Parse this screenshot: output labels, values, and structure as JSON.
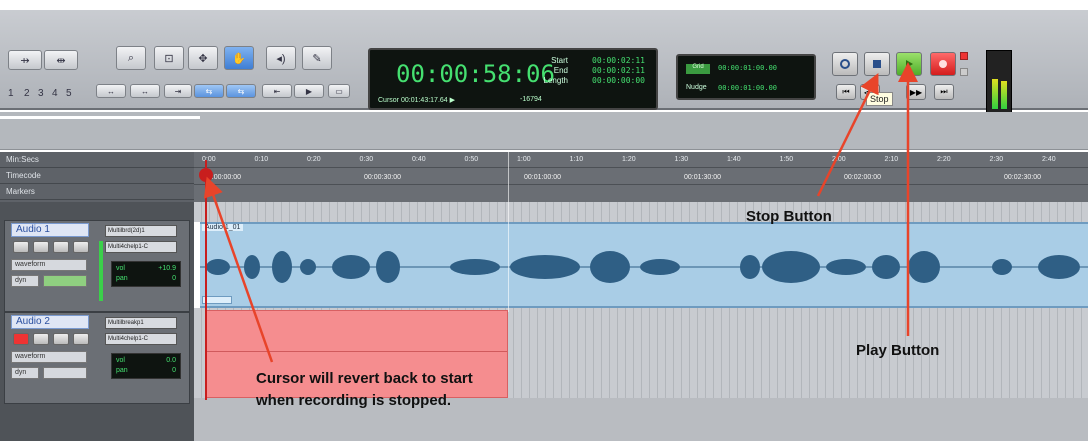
{
  "toolbar": {
    "nav_numbers": [
      "1",
      "2",
      "3",
      "4",
      "5"
    ],
    "counter": {
      "main_time": "00:00:58:06",
      "start_label": "Start",
      "end_label": "End",
      "length_label": "Length",
      "start_value": "00:00:02:11",
      "end_value": "00:00:02:11",
      "length_value": "00:00:00:00",
      "cursor_label": "Cursor",
      "cursor_value": "00:01:43:17.64",
      "bars_value": "-16794"
    },
    "nudge": {
      "grid_label": "Grid",
      "grid_value": "00:00:01:00.00",
      "nudge_label": "Nudge",
      "nudge_value": "00:00:01:00.00"
    },
    "transport": {
      "stop_tooltip": "Stop"
    }
  },
  "rulers": {
    "labels": [
      "Min:Secs",
      "Timecode",
      "Markers"
    ],
    "minsecs_ticks": [
      "0:00",
      "0:10",
      "0:20",
      "0:30",
      "0:40",
      "0:50",
      "1:00",
      "1:10",
      "1:20",
      "1:30",
      "1:40",
      "1:50",
      "2:00",
      "2:10",
      "2:20",
      "2:30",
      "2:40"
    ],
    "timecode_ticks": [
      "00:00:00:00",
      "00:00:30:00",
      "00:01:00:00",
      "00:01:30:00",
      "00:02:00:00",
      "00:02:30:00"
    ]
  },
  "tracks": [
    {
      "name": "Audio 1",
      "input": "Multilbrd(2d)1",
      "output": "Multi4chelp1-C",
      "view": "waveform",
      "dyn": "dyn",
      "vol_label": "vol",
      "vol_value": "+10.9",
      "pan_label": "pan",
      "pan_value": "0",
      "clip_name": "Audio 1_01"
    },
    {
      "name": "Audio 2",
      "input": "Multilbreakp1",
      "output": "Multi4chelp1-C",
      "view": "waveform",
      "dyn": "dyn",
      "vol_label": "vol",
      "vol_value": "0.0",
      "pan_label": "pan",
      "pan_value": "0"
    }
  ],
  "annotations": {
    "stop_button": "Stop Button",
    "play_button": "Play Button",
    "cursor_note_line1": "Cursor will revert back to start",
    "cursor_note_line2": "when recording is stopped."
  },
  "colors": {
    "annotation_arrow": "#e8442a",
    "record_region": "#f58d8f",
    "clip_fill": "#a9cde6",
    "waveform": "#2f5f85",
    "counter_green": "#45e070",
    "play_button": "#5fc233",
    "record_button": "#e02626"
  },
  "icons": [
    "zoom-icon",
    "trim-icon",
    "selector-icon",
    "grabber-icon",
    "scrub-icon",
    "pencil-icon",
    "online-icon",
    "stop-icon",
    "play-icon",
    "record-icon",
    "rewind-icon",
    "fast-forward-icon",
    "go-to-start-icon",
    "go-to-end-icon"
  ]
}
